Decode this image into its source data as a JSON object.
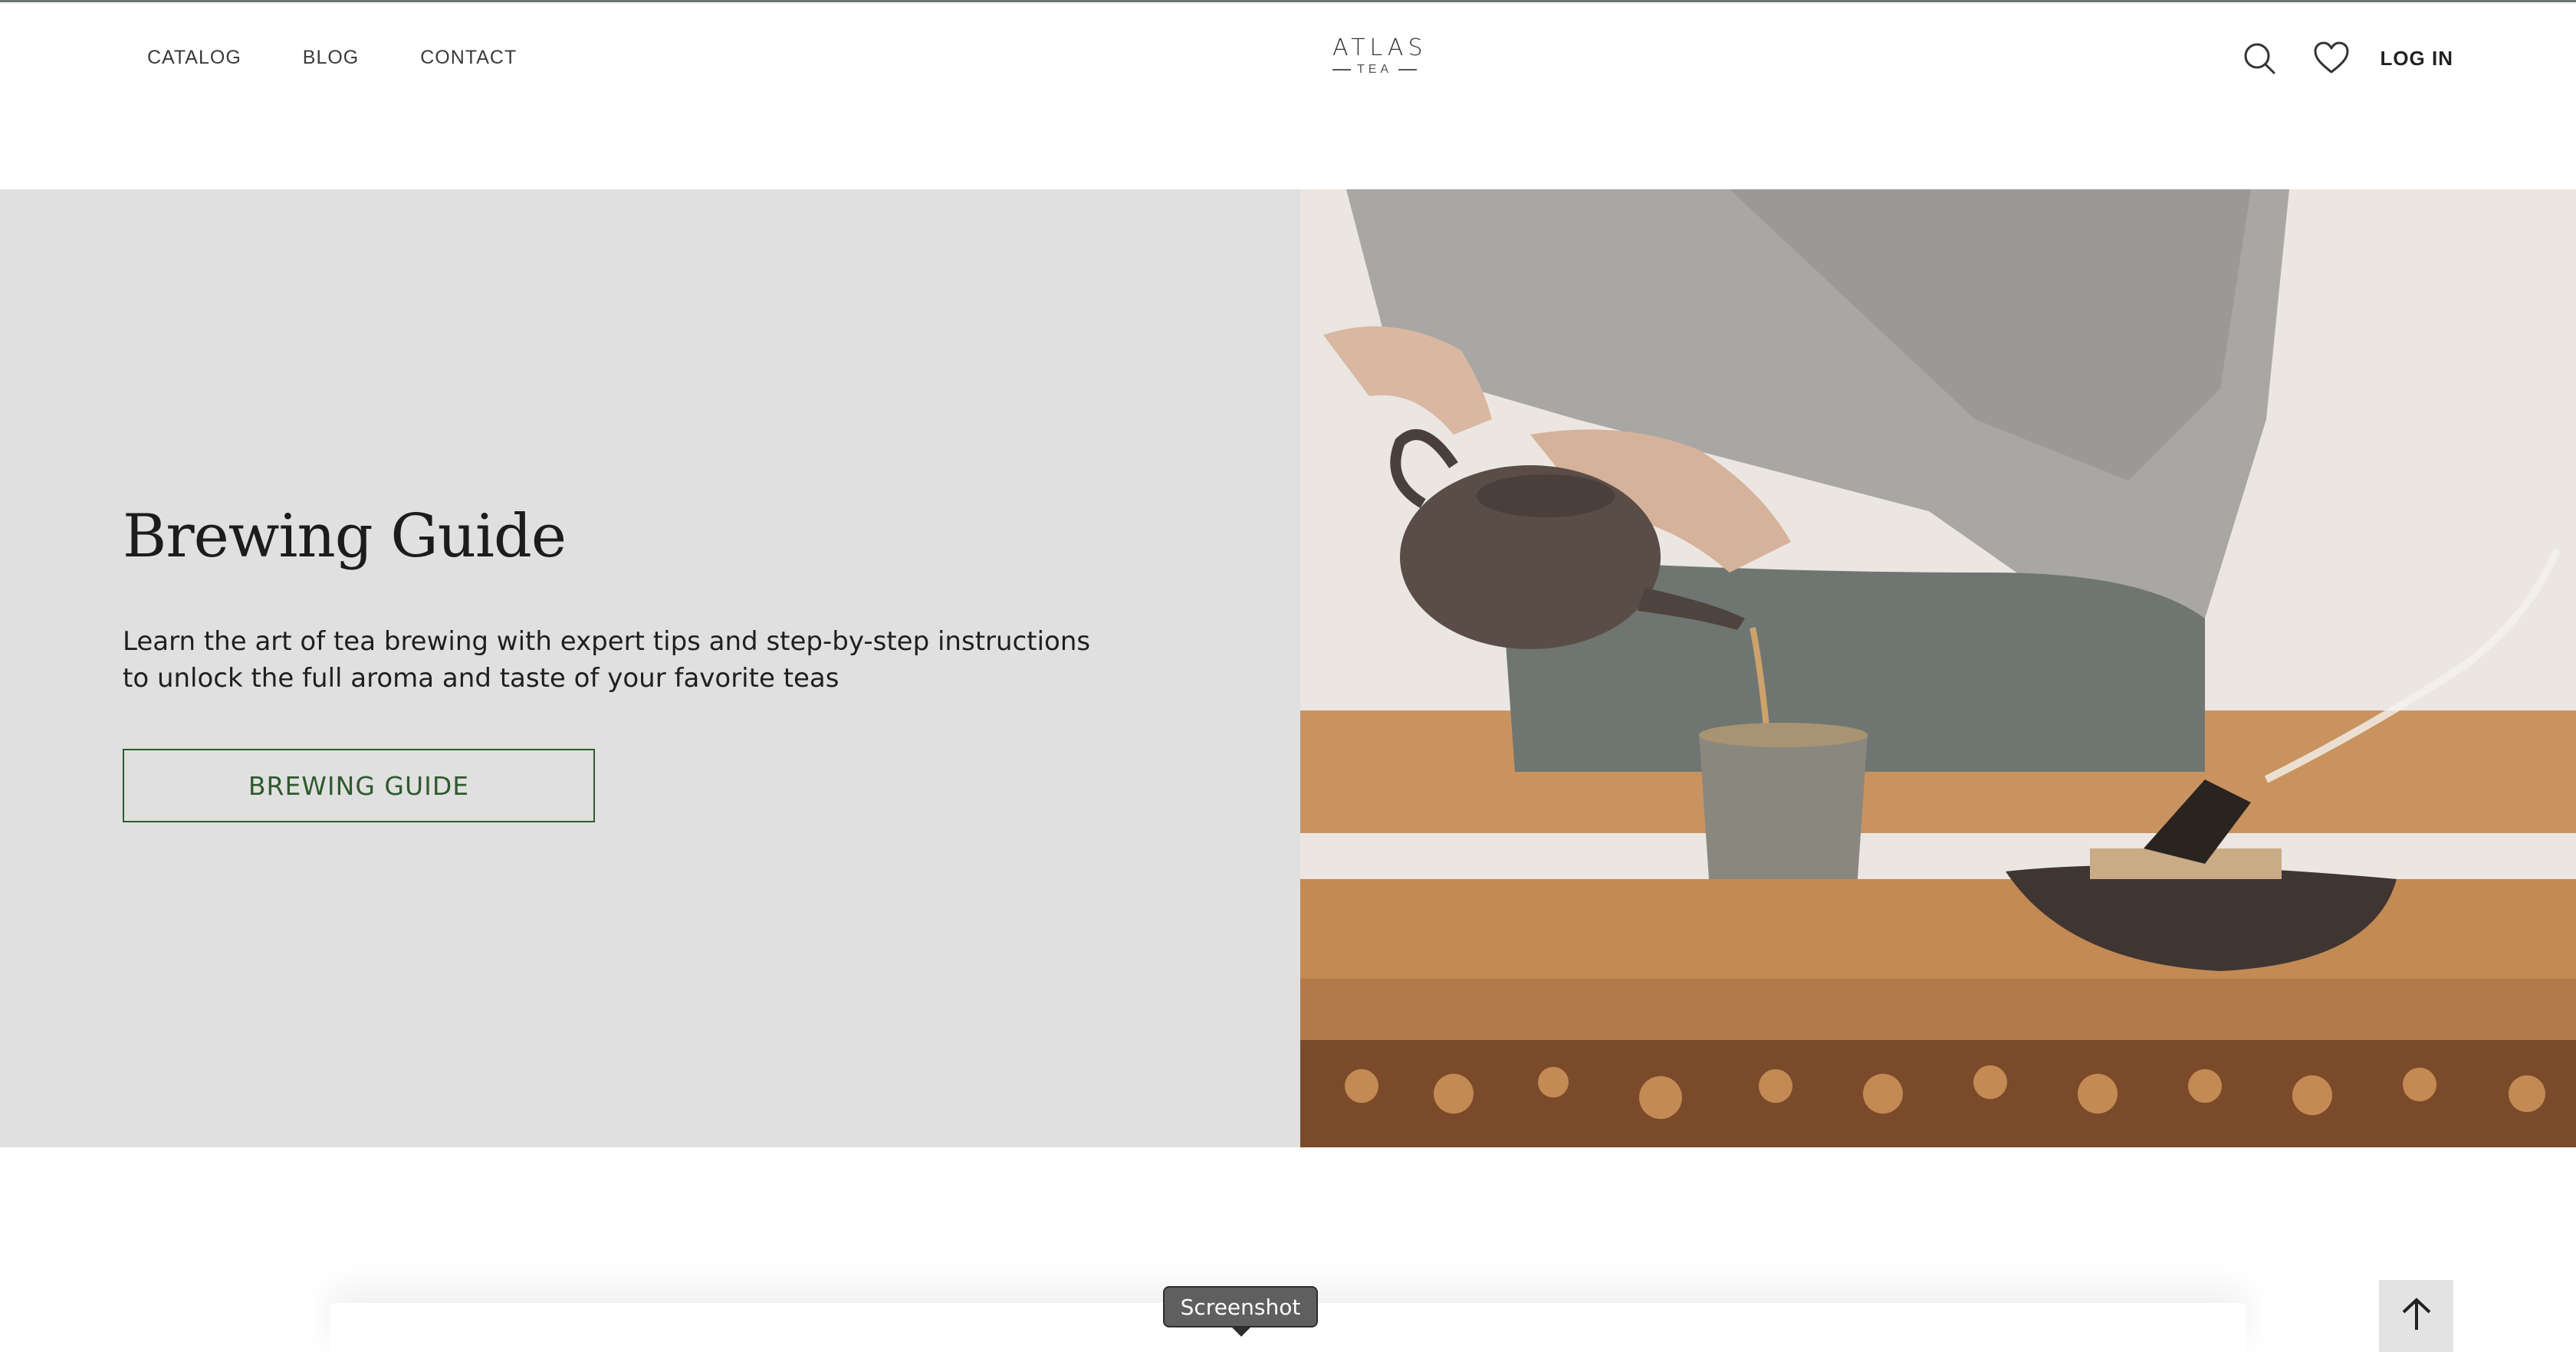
{
  "header": {
    "nav": [
      {
        "label": "CATALOG"
      },
      {
        "label": "BLOG"
      },
      {
        "label": "CONTACT"
      }
    ],
    "logo": {
      "main": "ATLAS",
      "sub": "TEA"
    },
    "icons": [
      "search-icon",
      "heart-icon"
    ],
    "login_label": "LOG IN"
  },
  "hero": {
    "title": "Brewing Guide",
    "description": "Learn the art of tea brewing with expert tips and step-by-step instructions to unlock the full aroma and taste of your favorite teas",
    "button_label": "BREWING GUIDE"
  },
  "tooltip": {
    "label": "Screenshot"
  },
  "back_to_top": {
    "icon": "arrow-up-icon"
  },
  "colors": {
    "accent_green": "#2f5a2f",
    "hero_bg": "#e0e0e0"
  }
}
